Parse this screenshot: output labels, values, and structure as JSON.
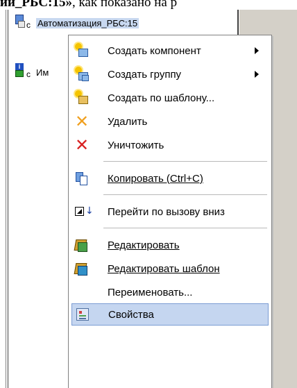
{
  "document": {
    "text_bold": "ии_РБС:15»",
    "text_rest": ", как показано на р"
  },
  "tree": {
    "items": [
      {
        "label": "Автоматизация_РБС:15",
        "selected": true,
        "icon": "component-icon"
      },
      {
        "label": "Им",
        "selected": false,
        "icon": "interface-icon"
      }
    ]
  },
  "context_menu": {
    "items": [
      {
        "label": "Создать компонент",
        "icon": "new-component-icon",
        "submenu": true
      },
      {
        "label": "Создать группу",
        "icon": "new-group-icon",
        "submenu": true
      },
      {
        "label": "Создать по шаблону...",
        "icon": "new-from-template-icon",
        "submenu": false
      },
      {
        "label": "Удалить",
        "icon": "delete-icon",
        "submenu": false
      },
      {
        "label": "Уничтожить",
        "icon": "destroy-icon",
        "submenu": false
      },
      {
        "label": "Копировать (Ctrl+C)",
        "icon": "copy-icon",
        "submenu": false
      },
      {
        "label": "Перейти по вызову вниз",
        "icon": "goto-call-down-icon",
        "submenu": false
      },
      {
        "label": "Редактировать",
        "icon": "edit-icon",
        "submenu": false
      },
      {
        "label": "Редактировать шаблон",
        "icon": "edit-template-icon",
        "submenu": false
      },
      {
        "label": "Переименовать...",
        "icon": "",
        "submenu": false
      },
      {
        "label": "Свойства",
        "icon": "properties-icon",
        "submenu": false,
        "highlighted": true
      }
    ]
  },
  "colors": {
    "highlight": "#c5d6f0",
    "highlight_border": "#7a9cd3",
    "delete_x": "#f0a020",
    "destroy_x": "#d82020"
  }
}
